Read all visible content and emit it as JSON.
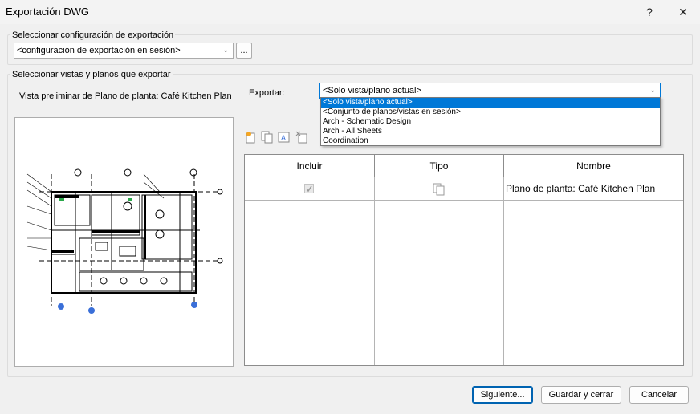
{
  "window": {
    "title": "Exportación DWG",
    "help": "?",
    "close": "✕"
  },
  "config_group": {
    "label": "Seleccionar configuración de exportación",
    "selected": "<configuración de exportación en sesión>",
    "more_button": "..."
  },
  "views_group": {
    "label": "Seleccionar vistas y planos que exportar",
    "preview_label": "Vista preliminar de Plano de planta: Café Kitchen Plan",
    "export_label": "Exportar:",
    "export_selected": "<Solo vista/plano actual>",
    "export_options": [
      "<Solo vista/plano actual>",
      "<Conjunto de planos/vistas en sesión>",
      "Arch - Schematic Design",
      "Arch - All Sheets",
      "Coordination"
    ],
    "toolbar_icons": [
      "new-set-icon",
      "duplicate-set-icon",
      "rename-set-icon",
      "delete-set-icon"
    ]
  },
  "table": {
    "columns": [
      "Incluir",
      "Tipo",
      "Nombre"
    ],
    "rows": [
      {
        "include": true,
        "type_icon": "floor-plan-icon",
        "name": "Plano de planta: Café Kitchen Plan"
      }
    ]
  },
  "buttons": {
    "next": "Siguiente...",
    "save_close": "Guardar y cerrar",
    "cancel": "Cancelar"
  },
  "colors": {
    "selection": "#0078d7",
    "default_button_border": "#0063b1"
  }
}
